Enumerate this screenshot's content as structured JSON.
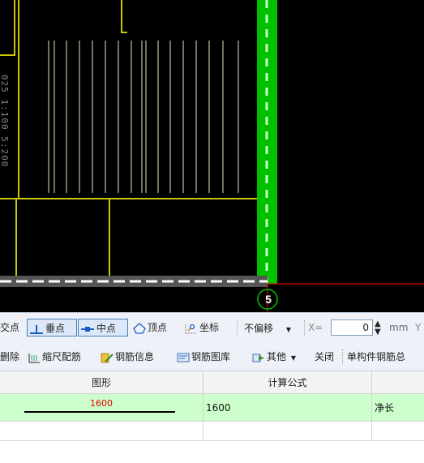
{
  "canvas": {
    "dimension_text": "025 1:100 5:200",
    "axis_label": "5",
    "colors": {
      "background": "#000000",
      "outline": "#c8c800",
      "rebar": "#e6e6c8",
      "column_green": "#00c000",
      "axis_red": "#ff0000"
    }
  },
  "snap_toolbar": {
    "items": [
      {
        "label": "交点",
        "icon": "intersection-icon",
        "active": false
      },
      {
        "label": "垂点",
        "icon": "perpendicular-icon",
        "active": true
      },
      {
        "label": "中点",
        "icon": "midpoint-icon",
        "active": true
      },
      {
        "label": "顶点",
        "icon": "vertex-icon",
        "active": false
      },
      {
        "label": "坐标",
        "icon": "coordinate-icon",
        "active": false
      }
    ],
    "offset_select": "不偏移",
    "x_label": "X=",
    "x_value": "0",
    "unit": "mm",
    "y_label": "Y"
  },
  "rebar_toolbar": {
    "items": [
      {
        "label": "删除",
        "icon": "delete-icon"
      },
      {
        "label": "缩尺配筋",
        "icon": "scale-rebar-icon"
      },
      {
        "label": "钢筋信息",
        "icon": "rebar-info-icon"
      },
      {
        "label": "钢筋图库",
        "icon": "rebar-library-icon"
      },
      {
        "label": "其他",
        "icon": "other-icon"
      },
      {
        "label": "关闭",
        "icon": ""
      },
      {
        "label": "单构件钢筋总",
        "icon": ""
      }
    ]
  },
  "table": {
    "headers": [
      "图形",
      "计算公式",
      ""
    ],
    "rows": [
      {
        "shape_value": "1600",
        "formula": "1600",
        "description": "净长",
        "selected": true
      },
      {
        "shape_value": "",
        "formula": "",
        "description": "",
        "selected": false
      }
    ]
  }
}
